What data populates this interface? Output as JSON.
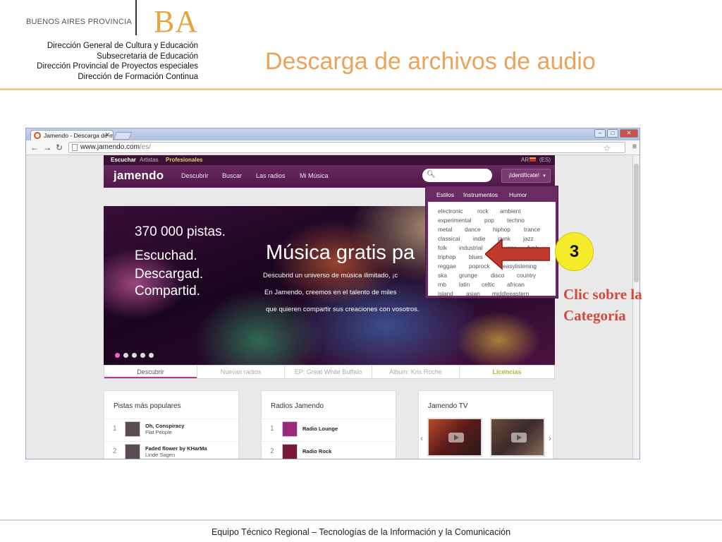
{
  "slide": {
    "province": "BUENOS AIRES PROVINCIA",
    "ba_logo": "BA",
    "direction_lines": [
      "Dirección General de Cultura y Educación",
      "Subsecretaria de Educación",
      "Dirección Provincial de Proyectos especiales",
      "Dirección de Formación Continua"
    ],
    "title": "Descarga de archivos de audio",
    "footer": "Equipo Técnico Regional – Tecnologías de la Información y la Comunicación",
    "accent_color": "#e9a35a",
    "annotation": {
      "step": "3",
      "line1": "Clic sobre la",
      "line2": "Categoría",
      "color": "#cf4a3d"
    }
  },
  "browser": {
    "tab_title": "Jamendo - Descarga de m",
    "url_host": "www.jamendo.com",
    "url_path": "/es/",
    "icons": [
      "back-icon",
      "forward-icon",
      "reload-icon",
      "star-icon",
      "menu-icon"
    ]
  },
  "jamendo": {
    "topline": {
      "escuchar": "Escuchar",
      "artistas": "Artistas",
      "profesionales": "Profesionales",
      "lang": "AR",
      "lang_code": "(ES)"
    },
    "logo": "jamendo",
    "nav": [
      "Descubrir",
      "Buscar",
      "Las radios",
      "Mi Música"
    ],
    "login": "¡Identifícate!",
    "hero": {
      "count": "370 000 pistas.",
      "lines": [
        "Escuchad.",
        "Descargad.",
        "Compartid."
      ],
      "headline": "Música gratis pa",
      "sub1": "Descubrid un universo de música ilimitado, ¡c",
      "sub2": "En Jamendo, creemos en el talento de miles",
      "sub3": "que quieren compartir sus creaciones con vosotros."
    },
    "subtabs": [
      "Descubrir",
      "Nuevas radios",
      "EP: Great White Buffalo",
      "Álbum: Kris Roche",
      "Licencias"
    ],
    "panels": {
      "popular": {
        "title": "Pistas más populares",
        "rows": [
          {
            "num": "1",
            "title": "Oh, Conspiracy",
            "artist": "Flat People"
          },
          {
            "num": "2",
            "title": "Faded flower by KHarMa",
            "artist": "Linde Sagen"
          }
        ]
      },
      "radios": {
        "title": "Radios Jamendo",
        "rows": [
          {
            "num": "1",
            "title": "Radio Lounge"
          },
          {
            "num": "2",
            "title": "Radio Rock"
          }
        ]
      },
      "tv": {
        "title": "Jamendo TV"
      }
    },
    "dropdown": {
      "tabs": [
        "Estilos",
        "Instrumentos",
        "Humor"
      ],
      "genres": [
        [
          "electronic",
          "rock",
          "ambient"
        ],
        [
          "experimental",
          "pop",
          "techno"
        ],
        [
          "metal",
          "dance",
          "hiphop",
          "trance"
        ],
        [
          "classical",
          "indie",
          "punk",
          "jazz"
        ],
        [
          "folk",
          "industrial",
          "lounge",
          "funk"
        ],
        [
          "triphop",
          "blues"
        ],
        [
          "reggae",
          "poprock",
          "easylistening"
        ],
        [
          "ska",
          "grunge",
          "disco",
          "country"
        ],
        [
          "rnb",
          "latin",
          "celtic",
          "african"
        ],
        [
          "island",
          "asian",
          "middleeastern"
        ]
      ]
    }
  }
}
